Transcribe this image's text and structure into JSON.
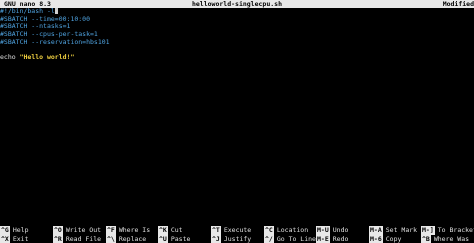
{
  "titlebar": {
    "app": "GNU nano 8.3",
    "filename": "helloworld-singlecpu.sh",
    "status": "Modified"
  },
  "editor": {
    "lines": [
      {
        "text": "#!/bin/bash -l",
        "type": "comment"
      },
      {
        "text": "#SBATCH --time=00:10:00",
        "type": "comment"
      },
      {
        "text": "#SBATCH --ntasks=1",
        "type": "comment"
      },
      {
        "text": "#SBATCH --cpus-per-task=1",
        "type": "comment"
      },
      {
        "text": "#SBATCH --reservation=hbs101",
        "type": "comment"
      },
      {
        "text": "",
        "type": "blank"
      },
      {
        "text_cmd": "echo ",
        "text_str": "\"Hello world!\"",
        "type": "code"
      }
    ]
  },
  "shortcuts": [
    {
      "key": "^G",
      "label": "Help"
    },
    {
      "key": "^X",
      "label": "Exit"
    },
    {
      "key": "^O",
      "label": "Write Out"
    },
    {
      "key": "^R",
      "label": "Read File"
    },
    {
      "key": "^F",
      "label": "Where Is"
    },
    {
      "key": "^\\",
      "label": "Replace"
    },
    {
      "key": "^K",
      "label": "Cut"
    },
    {
      "key": "^U",
      "label": "Paste"
    },
    {
      "key": "^T",
      "label": "Execute"
    },
    {
      "key": "^J",
      "label": "Justify"
    },
    {
      "key": "^C",
      "label": "Location"
    },
    {
      "key": "^/",
      "label": "Go To Line"
    },
    {
      "key": "M-U",
      "label": "Undo"
    },
    {
      "key": "M-E",
      "label": "Redo"
    },
    {
      "key": "M-A",
      "label": "Set Mark"
    },
    {
      "key": "M-6",
      "label": "Copy"
    },
    {
      "key": "M-]",
      "label": "To Bracket"
    },
    {
      "key": "^B",
      "label": "Where Was"
    }
  ]
}
